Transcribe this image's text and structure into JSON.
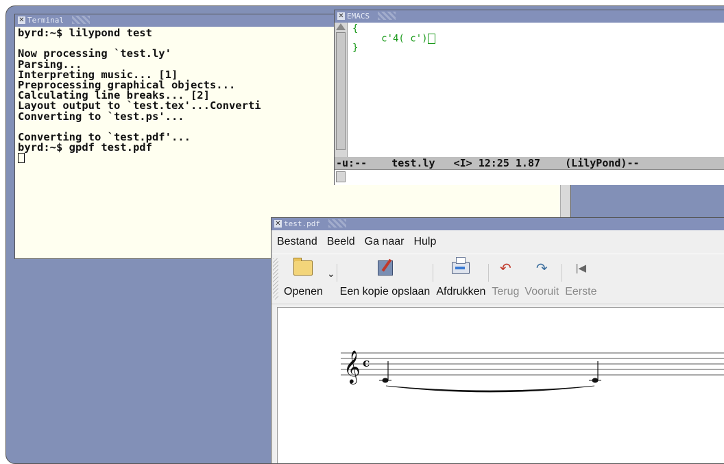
{
  "terminal": {
    "title": "Terminal",
    "lines": [
      "byrd:~$ lilypond test",
      "",
      "Now processing `test.ly'",
      "Parsing...",
      "Interpreting music... [1]",
      "Preprocessing graphical objects...",
      "Calculating line breaks... [2]",
      "Layout output to `test.tex'...Converti",
      "Converting to `test.ps'...",
      "",
      "Converting to `test.pdf'...",
      "byrd:~$ gpdf test.pdf"
    ]
  },
  "emacs": {
    "title": "EMACS",
    "code": [
      "{",
      "     c'4( c')",
      "}"
    ],
    "modeline": "-u:--    test.ly   <I> 12:25 1.87    (LilyPond)--"
  },
  "pdf": {
    "title": "test.pdf",
    "menu": [
      "Bestand",
      "Beeld",
      "Ga naar",
      "Hulp"
    ],
    "toolbar": {
      "open": "Openen",
      "save_copy": "Een kopie opslaan",
      "print": "Afdrukken",
      "back": "Terug",
      "forward": "Vooruit",
      "first": "Eerste"
    },
    "score": {
      "clef": "treble-clef",
      "time_signature": "c",
      "notes": [
        "c'4",
        "c'"
      ],
      "slur": true
    }
  },
  "colors": {
    "desktop": "#8290b7",
    "titlebar": "#8390ba",
    "terminal_bg": "#fffff0",
    "emacs_code": "#1a9a1a"
  }
}
